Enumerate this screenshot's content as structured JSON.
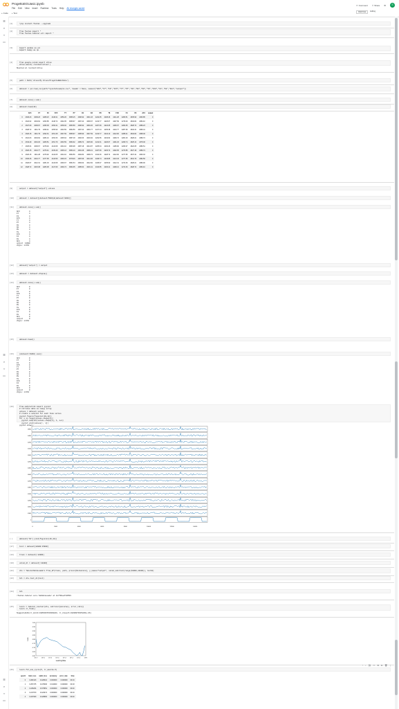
{
  "app": {
    "title": "ProgettoEGUasic.ipynb",
    "menu": [
      "File",
      "Edit",
      "View",
      "Insert",
      "Runtime",
      "Tools",
      "Help",
      "All changes saved"
    ],
    "toolbar": [
      "+ Code",
      "+ Text"
    ],
    "right": {
      "comment": "Comment",
      "share": "Share",
      "avatar": "S"
    },
    "ram": {
      "ram_label": "RAM",
      "disk_label": "Disk",
      "editing": "Editing"
    }
  },
  "cells": [
    {
      "n": "[1]",
      "code": "!pip install fastai --upgrade"
    },
    {
      "n": "[2]",
      "code": "from fastai import *\nfrom fastai.tabular.all import *"
    },
    {
      "n": "[3]",
      "code": "import pandas as pd\nimport numpy as np"
    },
    {
      "n": "[4]",
      "code": "from google.colab import drive\ndrive.mount('/content/drive')",
      "out": "Mounted at /content/drive"
    },
    {
      "n": "[5]",
      "code": "path = Path('drive/My Drive/ProgettoEEG/Data')"
    },
    {
      "n": "[6]",
      "code": "dataset = pd.read_csv(path/\"eyestatesample.csv\", header = None, names=[\"AF3\",\"F7\",\"F3\",\"FC5\",\"T7\",\"P7\",\"O1\",\"O2\",\"P8\",\"T8\",\"FC6\",\"F4\",\"F8\",\"AF4\",\"output\"])"
    },
    {
      "n": "[7]",
      "code": "dataset.isna().sum()"
    },
    {
      "n": "[8]",
      "code": "dataset.head(10)"
    }
  ],
  "head_table": {
    "columns": [
      "",
      "AF3",
      "F7",
      "F3",
      "FC5",
      "T7",
      "P7",
      "O1",
      "O2",
      "P8",
      "T8",
      "FC6",
      "F4",
      "F8",
      "AF4",
      "output"
    ],
    "rows": [
      [
        "0",
        "4329.23",
        "4009.23",
        "4289.23",
        "4148.21",
        "4350.26",
        "4586.15",
        "4096.92",
        "4641.03",
        "4222.05",
        "4238.46",
        "4211.28",
        "4280.51",
        "4635.90",
        "4393.85",
        "0"
      ],
      [
        "1",
        "4324.62",
        "4004.62",
        "4293.85",
        "4148.72",
        "4342.05",
        "4586.67",
        "4097.44",
        "4638.97",
        "4210.77",
        "4226.67",
        "4207.69",
        "4279.49",
        "4632.82",
        "4384.10",
        "0"
      ],
      [
        "2",
        "4327.69",
        "4006.67",
        "4295.38",
        "4156.41",
        "4336.92",
        "4583.59",
        "4096.92",
        "4630.26",
        "4207.69",
        "4222.05",
        "4206.67",
        "4282.05",
        "4628.72",
        "4389.23",
        "0"
      ],
      [
        "3",
        "4328.72",
        "4011.79",
        "4296.41",
        "4155.90",
        "4343.59",
        "4582.56",
        "4097.44",
        "4630.77",
        "4217.44",
        "4235.38",
        "4210.77",
        "4287.69",
        "4632.31",
        "4396.41",
        "0"
      ],
      [
        "4",
        "4326.15",
        "4011.79",
        "4292.31",
        "4151.28",
        "4347.69",
        "4586.67",
        "4095.90",
        "4627.69",
        "4210.77",
        "4244.10",
        "4212.82",
        "4288.21",
        "4632.82",
        "4398.46",
        "0"
      ],
      [
        "5",
        "4321.03",
        "4004.62",
        "4284.10",
        "4153.33",
        "4345.64",
        "4587.18",
        "4093.33",
        "4616.92",
        "4202.56",
        "4232.82",
        "4209.74",
        "4281.03",
        "4628.21",
        "4389.74",
        "0"
      ],
      [
        "6",
        "4319.49",
        "4001.03",
        "4280.51",
        "4151.79",
        "4343.59",
        "4584.62",
        "4089.74",
        "4615.90",
        "4212.31",
        "4226.67",
        "4201.03",
        "4269.74",
        "4625.13",
        "4378.46",
        "0"
      ],
      [
        "7",
        "4325.64",
        "4006.67",
        "4278.46",
        "4143.08",
        "4344.10",
        "4583.08",
        "4087.18",
        "4614.87",
        "4205.64",
        "4230.26",
        "4195.90",
        "4266.67",
        "4622.05",
        "4380.51",
        "0"
      ],
      [
        "8",
        "4326.15",
        "4010.77",
        "4276.41",
        "4139.49",
        "4345.13",
        "4584.10",
        "4091.28",
        "4608.21",
        "4187.69",
        "4229.74",
        "4202.05",
        "4273.85",
        "4627.18",
        "4389.74",
        "0"
      ],
      [
        "9",
        "4326.15",
        "4011.28",
        "4276.92",
        "4142.05",
        "4344.10",
        "4582.56",
        "4092.82",
        "4608.72",
        "4194.36",
        "4228.72",
        "4212.82",
        "4277.95",
        "4637.44",
        "4393.33",
        "0"
      ],
      [
        "10",
        "4330.26",
        "4010.77",
        "4277.95",
        "4143.59",
        "4346.15",
        "4578.46",
        "4087.69",
        "4614.36",
        "4189.74",
        "4233.85",
        "4213.33",
        "4277.95",
        "4631.79",
        "4382.56",
        "0"
      ],
      [
        "11",
        "4326.67",
        "4012.31",
        "4281.03",
        "4143.08",
        "4346.67",
        "4581.54",
        "4084.62",
        "4612.82",
        "4186.67",
        "4235.90",
        "4212.31",
        "4274.36",
        "4628.21",
        "4380.00",
        "0"
      ],
      [
        "12",
        "4328.72",
        "4015.38",
        "4283.08",
        "4147.69",
        "4349.74",
        "4582.05",
        "4085.64",
        "4616.41",
        "4193.85",
        "4236.41",
        "4208.21",
        "4274.36",
        "4628.72",
        "4384.10",
        "0"
      ]
    ]
  },
  "cells2": [
    {
      "n": "[9]",
      "code": "output = dataset[\"output\"].values"
    },
    {
      "n": "[10]",
      "code": "dataset = dataset[(dataset<5000)&(dataset>3200)]"
    },
    {
      "n": "[11]",
      "code": "dataset.isna().sum()",
      "out": "AF3         4\nF7          4\nF3          4\nFC5         4\nT7          4\nP7          4\nO1          4\nO2          4\nP8          4\nT8          4\nFC6         4\nF4          4\nF8          4\nAF4         4\noutput  14980\ndtype: int64"
    },
    {
      "n": "[12]",
      "code": "dataset['output'] = output"
    },
    {
      "n": "[13]",
      "code": "dataset = dataset.dropna()"
    },
    {
      "n": "[14]",
      "code": "dataset.isna().sum()",
      "out": "AF3         0\nF7          0\nF3          0\nFC5         0\nT7          0\nP7          0\nO1          0\nO2          0\nP8          0\nT8          0\nFC6         0\nF4          0\nF8          0\nAF4         0\noutput      0\ndtype: int64"
    },
    {
      "n": "[15]",
      "code": "dataset.head()"
    },
    {
      "n": "[16]",
      "code": "(dataset<=3200).sum()",
      "out": "AF3         0\nF7          0\nF3          0\nFC5         0\nT7          0\nP7          0\nO1          0\nO2          0\nP8          0\nT8          0\nFC6         0\nF4          0\nF8          0\nAF4         0\noutput      0\ndtype: int64"
    },
    {
      "n": "[20]",
      "code": "from matplotlib import pyplot\n# retrieve data as numpy array\nvalues = dataset.values\n# create a subplot for each time series\npyplot.figure(figsize=(20,10))\nfor i in range(values.shape[1]):\n  pyplot.subplot(values.shape[1], 1, i+1)\n  pyplot.plot(values[:, i])\npyplot.show()"
    }
  ],
  "timeseries_chart": {
    "type": "line",
    "x_ticks": [
      "0",
      "2000",
      "4000",
      "6000",
      "8000",
      "10000",
      "12000",
      "14000"
    ],
    "y_ticks": [
      "4800",
      "4400",
      "4200",
      "4100",
      "4000",
      "4200",
      "4400",
      "4600",
      "4200",
      "4300",
      "4200",
      "4200",
      "4000",
      "4300",
      "1"
    ]
  },
  "cells3": [
    {
      "n": "[ ]",
      "code": "dataset['F8'].plot(figsize=(40,10))"
    },
    {
      "n": "[17]",
      "code": "test = dataset[12800:15000]"
    },
    {
      "n": "[18]",
      "code": "train = dataset[:12800]"
    },
    {
      "n": "[19]",
      "code": "valid_dl = dataset[:12800]"
    },
    {
      "n": "[22]",
      "code": "dls = TabularDataLoaders.from_df(train, path, procs=[Normalize], y_names=\"output\", valid_idx=list(range(10000,12800)), bs=64)"
    },
    {
      "n": "[23]",
      "code": "tdl = dls.test_dl(test)"
    },
    {
      "n": "[24]",
      "code": "tdl",
      "out": "<fastai.tabular.core.TabDataLoader at 0x7f0beaf13650>"
    },
    {
      "n": "[25]",
      "code": "learn = tabular_learner(dls, metrics=[accuracy, error_rate])\nlearn.lr_find()",
      "out": "SuggestedLRs(lr_min=0.19054607152938843, lr_steep=6.918309736251831e-06)"
    }
  ],
  "lr_chart": {
    "type": "line",
    "xlabel": "Learning Rate",
    "ylabel": "Loss",
    "y_ticks": [
      "1.00",
      "0.95",
      "0.90",
      "0.85",
      "0.80",
      "0.75",
      "0.70",
      "0.65",
      "0.60"
    ],
    "x_ticks": [
      "10^-7",
      "10^-6",
      "10^-5",
      "10^-4",
      "10^-3",
      "10^-2",
      "10^-1",
      "10^0"
    ]
  },
  "fit_cell": {
    "n": "[26]",
    "code": "learn.fit_one_cycle(5, lr_max=1e-5)"
  },
  "fit_table": {
    "columns": [
      "epoch",
      "train_loss",
      "valid_loss",
      "accuracy",
      "error_rate",
      "time"
    ],
    "rows": [
      [
        "0",
        "0.282143",
        "0.228410",
        "0.000000",
        "0.000000",
        "00:19"
      ],
      [
        "1",
        "0.257475",
        "0.278496",
        "0.010000",
        "0.000000",
        "00:18"
      ],
      [
        "2",
        "0.246234",
        "0.376951",
        "0.000000",
        "0.000000",
        "00:20"
      ],
      [
        "3",
        "0.217970",
        "0.423474",
        "0.000000",
        "0.000000",
        "00:19"
      ],
      [
        "4",
        "0.227930",
        "0.428960",
        "0.000000",
        "0.000000",
        "00:20"
      ]
    ]
  }
}
